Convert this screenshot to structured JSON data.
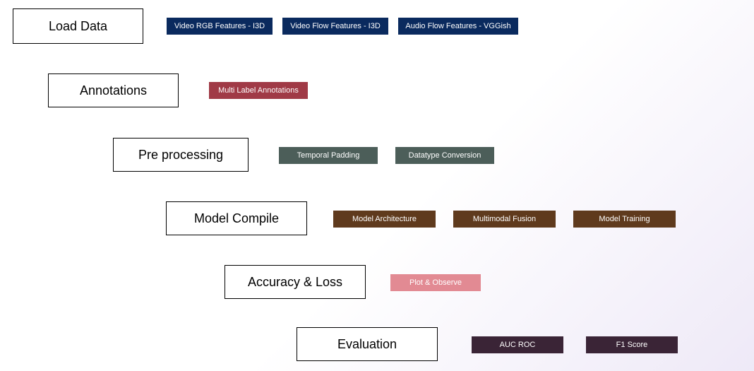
{
  "stages": {
    "load_data": {
      "label": "Load Data"
    },
    "annotations": {
      "label": "Annotations"
    },
    "preprocessing": {
      "label": "Pre processing"
    },
    "model_compile": {
      "label": "Model Compile"
    },
    "accuracy_loss": {
      "label": "Accuracy & Loss"
    },
    "evaluation": {
      "label": "Evaluation"
    }
  },
  "chips": {
    "load_data": [
      "Video RGB Features - I3D",
      "Video Flow Features - I3D",
      "Audio Flow Features - VGGish"
    ],
    "annotations": [
      "Multi Label Annotations"
    ],
    "preprocessing": [
      "Temporal Padding",
      "Datatype Conversion"
    ],
    "model_compile": [
      "Model Architecture",
      "Multimodal Fusion",
      "Model Training"
    ],
    "accuracy_loss": [
      "Plot & Observe"
    ],
    "evaluation": [
      "AUC ROC",
      "F1 Score"
    ]
  }
}
